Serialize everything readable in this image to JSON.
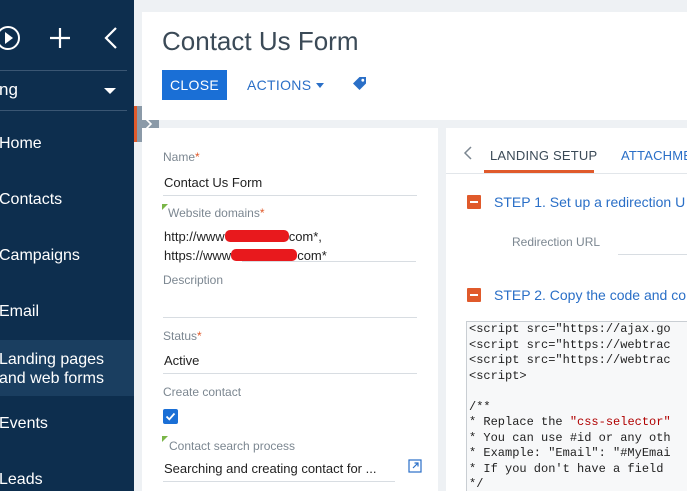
{
  "sidebar": {
    "workspace_label": "ng",
    "items": [
      {
        "label": "Home"
      },
      {
        "label": "Contacts"
      },
      {
        "label": "Campaigns"
      },
      {
        "label": "Email"
      },
      {
        "label": "Landing pages and web forms",
        "active": true
      },
      {
        "label": "Events"
      },
      {
        "label": "Leads"
      }
    ]
  },
  "header": {
    "title": "Contact Us Form",
    "close_label": "CLOSE",
    "actions_label": "ACTIONS"
  },
  "form": {
    "name_label": "Name",
    "name_value": "Contact Us Form",
    "domains_label": "Website domains",
    "domain_1_prefix": "http://www",
    "domain_1_suffix": "com*,",
    "domain_2_prefix": "https://www",
    "domain_2_suffix": "com*",
    "description_label": "Description",
    "status_label": "Status",
    "status_value": "Active",
    "create_contact_label": "Create contact",
    "create_contact_checked": true,
    "search_process_label": "Contact search process",
    "search_process_value": "Searching and creating contact for ..."
  },
  "right_panel": {
    "tabs": [
      "LANDING SETUP",
      "ATTACHME"
    ],
    "step1": "STEP 1. Set up a redirection U",
    "redirection_url_label": "Redirection URL",
    "step2": "STEP 2. Copy the code and co",
    "code_lines": [
      "<script src=\"https://ajax.go",
      "<script src=\"https://webtrac",
      "<script src=\"https://webtrac",
      "<script>",
      "",
      "/**",
      "* Replace the \"css-selector\"",
      "* You can use #id or any oth",
      "* Example: \"Email\": \"#MyEmai",
      "* If you don't have a field",
      "*/"
    ]
  },
  "colors": {
    "sidebar_bg": "#0d2e4e",
    "primary_button": "#1a6fd6",
    "accent": "#e05a2b",
    "link": "#2a6fc7"
  },
  "icons": [
    "play-icon",
    "plus-icon",
    "chevron-left-icon",
    "chevron-right-icon",
    "tag-icon",
    "open-link-icon",
    "checkmark-icon",
    "collapse-icon"
  ]
}
